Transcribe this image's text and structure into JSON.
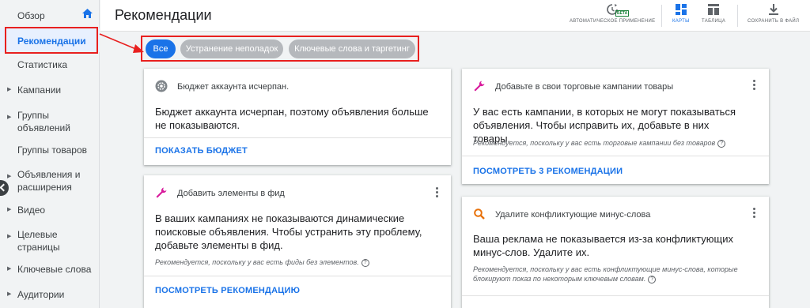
{
  "sidebar": {
    "items": [
      {
        "label": "Обзор"
      },
      {
        "label": "Рекомендации"
      },
      {
        "label": "Статистика"
      },
      {
        "label": "Кампании"
      },
      {
        "label": "Группы\nобъявлений"
      },
      {
        "label": "Группы товаров"
      },
      {
        "label": "Объявления и\nрасширения"
      },
      {
        "label": "Видео"
      },
      {
        "label": "Целевые\nстраницы"
      },
      {
        "label": "Ключевые слова"
      },
      {
        "label": "Аудитории"
      }
    ]
  },
  "header": {
    "title": "Рекомендации",
    "tools": {
      "auto_apply": "АВТОМАТИЧЕСКОЕ ПРИМЕНЕНИЕ",
      "beta": "БЕТА",
      "cards": "КАРТЫ",
      "table": "ТАБЛИЦА",
      "save": "СОХРАНИТЬ В ФАЙЛ"
    }
  },
  "filters": {
    "all": "Все",
    "troubleshooting": "Устранение неполадок",
    "keywords": "Ключевые слова и таргетинг"
  },
  "cards": {
    "budget": {
      "title": "Бюджет аккаунта исчерпан.",
      "body": "Бюджет аккаунта исчерпан, поэтому объявления больше не показываются.",
      "link": "ПОКАЗАТЬ БЮДЖЕТ"
    },
    "feed": {
      "title": "Добавить элементы в фид",
      "body": "В ваших кампаниях не показываются динамические поисковые объявления. Чтобы устранить эту проблему, добавьте элементы в фид.",
      "note": "Рекомендуется, поскольку у вас есть фиды без элементов.",
      "link": "ПОСМОТРЕТЬ РЕКОМЕНДАЦИЮ"
    },
    "products": {
      "title": "Добавьте в свои торговые кампании товары",
      "body": "У вас есть кампании, в которых не могут показываться объявления. Чтобы исправить их, добавьте в них товары.",
      "note": "Рекомендуется, поскольку у вас есть торговые кампании без товаров",
      "link": "ПОСМОТРЕТЬ 3 РЕКОМЕНДАЦИИ"
    },
    "negatives": {
      "title": "Удалите конфликтующие минус-слова",
      "body": "Ваша реклама не показывается из-за конфликтующих минус-слов. Удалите их.",
      "note": "Рекомендуется, поскольку у вас есть конфликтующие минус-слова, которые блокируют показ по некоторым ключевым словам."
    }
  },
  "colors": {
    "accent": "#1a73e8",
    "highlight": "#e8201f",
    "chip_inactive": "#b5b8bc"
  },
  "icons": [
    "home-icon",
    "auto-apply-icon",
    "cards-icon",
    "table-icon",
    "download-icon",
    "gear-icon",
    "wrench-icon",
    "search-icon",
    "kebab-icon",
    "help-icon"
  ]
}
